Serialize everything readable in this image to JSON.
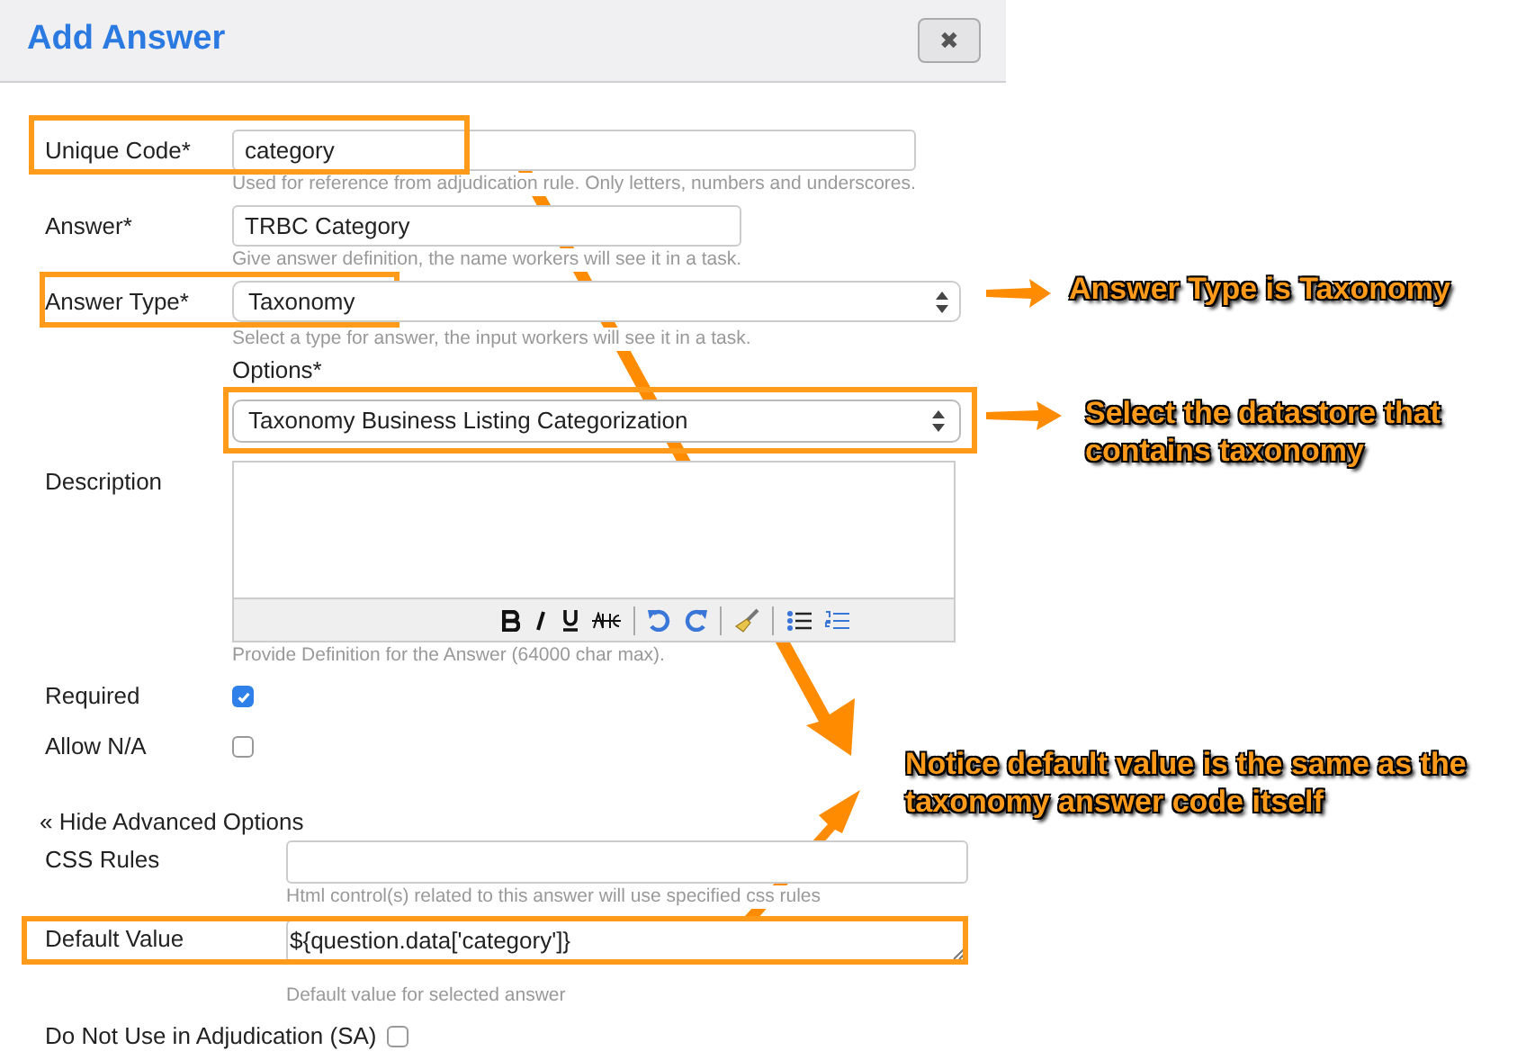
{
  "dialog": {
    "title": "Add Answer",
    "close_label": "✖"
  },
  "fields": [
    {
      "kind": "text",
      "label": "Unique Code*",
      "value": "category",
      "hint": "Used for reference from adjudication rule. Only letters, numbers and underscores.",
      "highlighted": true
    },
    {
      "kind": "text",
      "label": "Answer*",
      "value": "TRBC Category",
      "hint": "Give answer definition, the name workers will see it in a task."
    },
    {
      "kind": "select",
      "label": "Answer Type*",
      "value": "Taxonomy",
      "hint": "Select a type for answer, the input workers will see it in a task.",
      "highlighted": true
    },
    {
      "kind": "select_above",
      "label": "Options*",
      "value": "Taxonomy Business Listing Categorization",
      "highlighted": true
    },
    {
      "kind": "editor",
      "label": "Description",
      "hint": "Provide Definition for the Answer (64000 char max)."
    },
    {
      "kind": "checkbox",
      "label": "Required",
      "checked": true
    },
    {
      "kind": "checkbox",
      "label": "Allow N/A",
      "checked": false
    }
  ],
  "advanced_toggle": "« Hide Advanced Options",
  "advanced_fields": [
    {
      "kind": "text",
      "label": "CSS Rules",
      "hint": "Html control(s) related to this answer will use specified css rules"
    },
    {
      "kind": "textarea",
      "label": "Default Value",
      "value": "${question.data['category']}",
      "hint": "Default value for selected answer",
      "highlighted": true
    },
    {
      "kind": "inline_checkbox",
      "label": "Do Not Use in Adjudication (SA)",
      "checked": false
    }
  ],
  "annotations": [
    "Answer Type is Taxonomy",
    "Select the datastore that contains taxonomy",
    "Notice default value is the same as the taxonomy answer code itself"
  ]
}
